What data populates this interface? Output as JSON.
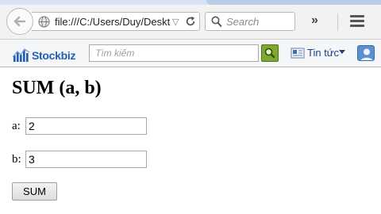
{
  "browser": {
    "url": "file:///C:/Users/Duy/Desktop/sum.html",
    "search_placeholder": "Search",
    "overflow_symbol": "»"
  },
  "toolbar": {
    "logo_text": "Stockbiz",
    "search_placeholder": "Tìm kiếm",
    "news_label": "Tin tức"
  },
  "page": {
    "title": "SUM (a, b)",
    "field_a": {
      "label": "a:",
      "value": "2"
    },
    "field_b": {
      "label": "b:",
      "value": "3"
    },
    "submit_label": "SUM"
  },
  "colors": {
    "chrome_bg": "#f2f2f2",
    "toolbar_bg": "#f5f6f7",
    "logo_blue": "#1f5fb3",
    "search_go_green": "#7fa830",
    "news_text": "#1d3f8a"
  },
  "icons": [
    "back-arrow-icon",
    "globe-icon",
    "dropdown-icon",
    "reload-icon",
    "search-icon",
    "overflow-icon",
    "menu-icon",
    "stockbiz-logo-icon",
    "magnifier-icon",
    "news-icon",
    "user-icon"
  ]
}
